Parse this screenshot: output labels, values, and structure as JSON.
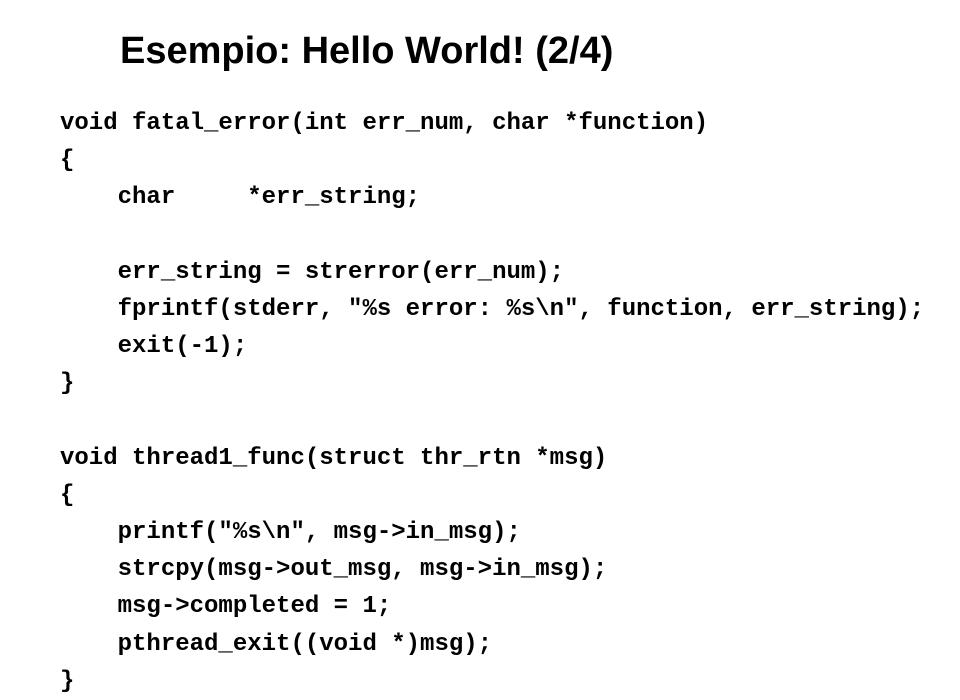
{
  "title": "Esempio: Hello World! (2/4)",
  "code": {
    "line1": "void fatal_error(int err_num, char *function)",
    "line2": "{",
    "line3": "    char     *err_string;",
    "line4": "",
    "line5": "    err_string = strerror(err_num);",
    "line6": "    fprintf(stderr, \"%s error: %s\\n\", function, err_string);",
    "line7": "    exit(-1);",
    "line8": "}",
    "line9": "",
    "line10": "void thread1_func(struct thr_rtn *msg)",
    "line11": "{",
    "line12": "    printf(\"%s\\n\", msg->in_msg);",
    "line13": "    strcpy(msg->out_msg, msg->in_msg);",
    "line14": "    msg->completed = 1;",
    "line15": "    pthread_exit((void *)msg);",
    "line16": "}"
  }
}
